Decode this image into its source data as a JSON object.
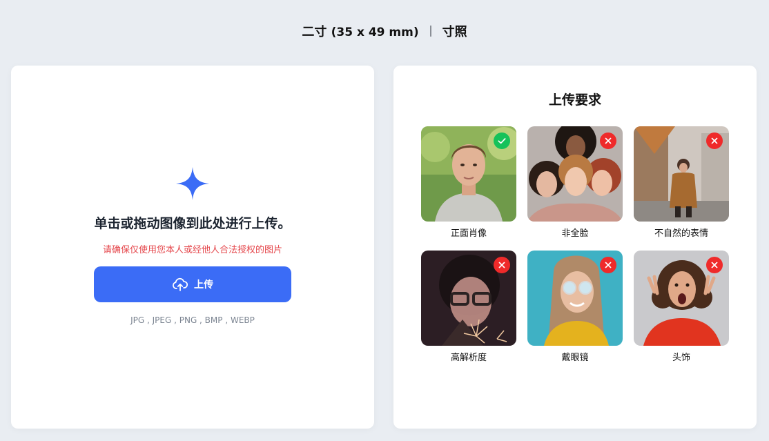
{
  "header": {
    "size_name": "二寸",
    "size_dims": "(35 x 49 mm)",
    "photo_type": "寸照"
  },
  "upload": {
    "title": "单击或拖动图像到此处进行上传。",
    "warning": "请确保仅使用您本人或经他人合法授权的图片",
    "button_label": "上传",
    "formats": "JPG , JPEG , PNG , BMP , WEBP",
    "accent_color": "#3b6cf6",
    "warning_color": "#e5484d"
  },
  "requirements": {
    "title": "上传要求",
    "items": [
      {
        "label": "正面肖像",
        "status": "accepted",
        "icon": "check-icon"
      },
      {
        "label": "非全脸",
        "status": "rejected",
        "icon": "close-icon"
      },
      {
        "label": "不自然的表情",
        "status": "rejected",
        "icon": "close-icon"
      },
      {
        "label": "高解析度",
        "status": "rejected",
        "icon": "close-icon"
      },
      {
        "label": "戴眼镜",
        "status": "rejected",
        "icon": "close-icon"
      },
      {
        "label": "头饰",
        "status": "rejected",
        "icon": "close-icon"
      }
    ],
    "accepted_color": "#16c25a",
    "rejected_color": "#ef2a2a"
  }
}
